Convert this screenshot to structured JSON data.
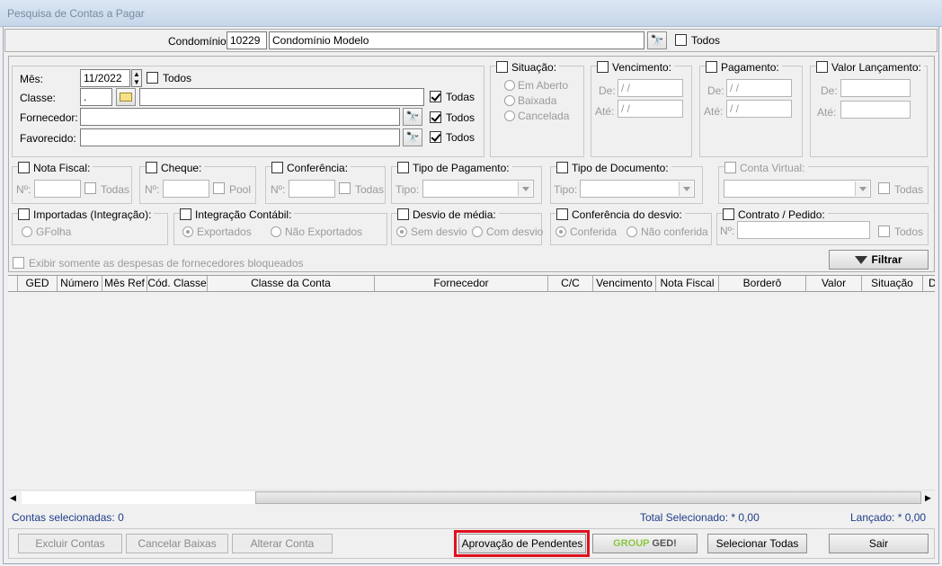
{
  "window": {
    "title": "Pesquisa de Contas a Pagar"
  },
  "condominio": {
    "label": "Condomínio:",
    "code": "10229",
    "name": "Condomínio Modelo",
    "todos_label": "Todos"
  },
  "filters": {
    "mes_label": "Mês:",
    "mes_value": "11/2022",
    "mes_todos": "Todos",
    "classe_label": "Classe:",
    "classe_code": ".",
    "classe_todas": "Todas",
    "fornecedor_label": "Fornecedor:",
    "fornecedor_todos": "Todos",
    "favorecido_label": "Favorecido:",
    "favorecido_todos": "Todos"
  },
  "situacao": {
    "title": "Situação:",
    "options": [
      "Em Aberto",
      "Baixada",
      "Cancelada"
    ]
  },
  "vencimento": {
    "title": "Vencimento:",
    "de": "De:",
    "ate": "Até:",
    "de_value": " / /",
    "ate_value": " / /"
  },
  "pagamento": {
    "title": "Pagamento:",
    "de": "De:",
    "ate": "Até:",
    "de_value": " / /",
    "ate_value": " / /"
  },
  "valor": {
    "title": "Valor Lançamento:",
    "de": "De:",
    "ate": "Até:"
  },
  "nota_fiscal": {
    "title": "Nota Fiscal:",
    "no": "Nº:",
    "todas": "Todas"
  },
  "cheque": {
    "title": "Cheque:",
    "no": "Nº:",
    "pool": "Pool"
  },
  "conferencia": {
    "title": "Conferência:",
    "no": "Nº:",
    "todas": "Todas"
  },
  "tipo_pagamento": {
    "title": "Tipo de Pagamento:",
    "tipo": "Tipo:"
  },
  "tipo_documento": {
    "title": "Tipo de Documento:",
    "tipo": "Tipo:"
  },
  "conta_virtual": {
    "title": "Conta Virtual:",
    "todas": "Todas"
  },
  "importadas": {
    "title": "Importadas (Integração):",
    "option": "GFolha"
  },
  "integracao": {
    "title": "Integração Contábil:",
    "options": [
      "Exportados",
      "Não Exportados"
    ]
  },
  "desvio": {
    "title": "Desvio de média:",
    "options": [
      "Sem desvio",
      "Com desvio"
    ]
  },
  "conf_desvio": {
    "title": "Conferência do desvio:",
    "options": [
      "Conferida",
      "Não conferida"
    ]
  },
  "contrato": {
    "title": "Contrato / Pedido:",
    "no": "Nº:",
    "todos": "Todos"
  },
  "bloqueados_label": "Exibir somente as despesas de fornecedores bloqueados",
  "filtrar_label": "Filtrar",
  "grid": {
    "columns": [
      "GED",
      "Número",
      "Mês Ref",
      "Cód. Classe",
      "Classe da Conta",
      "Fornecedor",
      "C/C",
      "Vencimento",
      "Nota Fiscal",
      "Borderô",
      "Valor",
      "Situação",
      "D"
    ]
  },
  "status": {
    "contas_selecionadas": "Contas selecionadas: 0",
    "total_selecionado": "Total Selecionado: * 0,00",
    "lancado": "Lançado: * 0,00"
  },
  "buttons": {
    "excluir": "Excluir Contas",
    "cancelar": "Cancelar Baixas",
    "alterar": "Alterar Conta",
    "aprovacao": "Aprovação de Pendentes",
    "ged_group": "GROUP",
    "ged_ged": "GED!",
    "selecionar": "Selecionar Todas",
    "sair": "Sair"
  },
  "icons": {
    "search": "binoculars-icon",
    "folder": "folder-icon",
    "filter": "funnel-icon"
  },
  "colors": {
    "highlight": "#e0101e",
    "status_text": "#1f3d8a"
  }
}
